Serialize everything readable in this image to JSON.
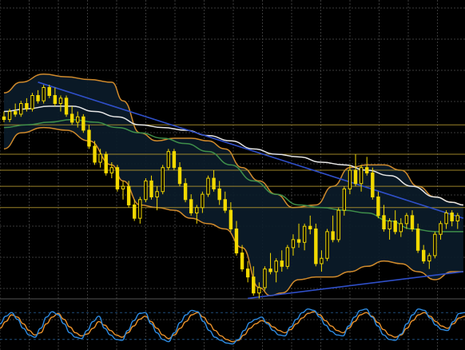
{
  "chart_data": {
    "type": "candlestick",
    "title": "",
    "xlabel": "",
    "ylabel": "",
    "grid": true,
    "price_panel": {
      "ylim": [
        0,
        100
      ],
      "candles": [
        {
          "x": 1,
          "o": 64,
          "h": 66,
          "l": 62,
          "c": 63
        },
        {
          "x": 2,
          "o": 63,
          "h": 67,
          "l": 62,
          "c": 66
        },
        {
          "x": 3,
          "o": 66,
          "h": 69,
          "l": 64,
          "c": 65
        },
        {
          "x": 4,
          "o": 65,
          "h": 70,
          "l": 64,
          "c": 69
        },
        {
          "x": 5,
          "o": 69,
          "h": 71,
          "l": 66,
          "c": 67
        },
        {
          "x": 6,
          "o": 67,
          "h": 73,
          "l": 66,
          "c": 72
        },
        {
          "x": 7,
          "o": 72,
          "h": 74,
          "l": 69,
          "c": 70
        },
        {
          "x": 8,
          "o": 70,
          "h": 76,
          "l": 69,
          "c": 75
        },
        {
          "x": 9,
          "o": 75,
          "h": 76,
          "l": 71,
          "c": 72
        },
        {
          "x": 10,
          "o": 72,
          "h": 75,
          "l": 68,
          "c": 69
        },
        {
          "x": 11,
          "o": 69,
          "h": 72,
          "l": 66,
          "c": 71
        },
        {
          "x": 12,
          "o": 71,
          "h": 72,
          "l": 64,
          "c": 65
        },
        {
          "x": 13,
          "o": 65,
          "h": 68,
          "l": 61,
          "c": 62
        },
        {
          "x": 14,
          "o": 62,
          "h": 66,
          "l": 60,
          "c": 64
        },
        {
          "x": 15,
          "o": 64,
          "h": 65,
          "l": 58,
          "c": 59
        },
        {
          "x": 16,
          "o": 59,
          "h": 61,
          "l": 52,
          "c": 53
        },
        {
          "x": 17,
          "o": 53,
          "h": 55,
          "l": 46,
          "c": 47
        },
        {
          "x": 18,
          "o": 47,
          "h": 52,
          "l": 45,
          "c": 50
        },
        {
          "x": 19,
          "o": 50,
          "h": 51,
          "l": 42,
          "c": 43
        },
        {
          "x": 20,
          "o": 43,
          "h": 47,
          "l": 41,
          "c": 45
        },
        {
          "x": 21,
          "o": 45,
          "h": 46,
          "l": 36,
          "c": 37
        },
        {
          "x": 22,
          "o": 37,
          "h": 40,
          "l": 33,
          "c": 38
        },
        {
          "x": 23,
          "o": 38,
          "h": 40,
          "l": 30,
          "c": 31
        },
        {
          "x": 24,
          "o": 31,
          "h": 33,
          "l": 25,
          "c": 26
        },
        {
          "x": 25,
          "o": 26,
          "h": 34,
          "l": 24,
          "c": 33
        },
        {
          "x": 26,
          "o": 33,
          "h": 41,
          "l": 32,
          "c": 40
        },
        {
          "x": 27,
          "o": 40,
          "h": 42,
          "l": 33,
          "c": 34
        },
        {
          "x": 28,
          "o": 34,
          "h": 38,
          "l": 29,
          "c": 36
        },
        {
          "x": 29,
          "o": 36,
          "h": 46,
          "l": 35,
          "c": 45
        },
        {
          "x": 30,
          "o": 45,
          "h": 52,
          "l": 44,
          "c": 51
        },
        {
          "x": 31,
          "o": 51,
          "h": 52,
          "l": 44,
          "c": 45
        },
        {
          "x": 32,
          "o": 45,
          "h": 47,
          "l": 38,
          "c": 39
        },
        {
          "x": 33,
          "o": 39,
          "h": 41,
          "l": 32,
          "c": 33
        },
        {
          "x": 34,
          "o": 33,
          "h": 35,
          "l": 27,
          "c": 28
        },
        {
          "x": 35,
          "o": 28,
          "h": 31,
          "l": 24,
          "c": 30
        },
        {
          "x": 36,
          "o": 30,
          "h": 36,
          "l": 28,
          "c": 35
        },
        {
          "x": 37,
          "o": 35,
          "h": 42,
          "l": 34,
          "c": 41
        },
        {
          "x": 38,
          "o": 41,
          "h": 44,
          "l": 36,
          "c": 37
        },
        {
          "x": 39,
          "o": 37,
          "h": 40,
          "l": 31,
          "c": 33
        },
        {
          "x": 40,
          "o": 33,
          "h": 36,
          "l": 28,
          "c": 29
        },
        {
          "x": 41,
          "o": 29,
          "h": 32,
          "l": 21,
          "c": 22
        },
        {
          "x": 42,
          "o": 22,
          "h": 25,
          "l": 12,
          "c": 13
        },
        {
          "x": 43,
          "o": 13,
          "h": 16,
          "l": 6,
          "c": 7
        },
        {
          "x": 44,
          "o": 7,
          "h": 10,
          "l": 2,
          "c": 4
        },
        {
          "x": 45,
          "o": 4,
          "h": 8,
          "l": -3,
          "c": -2
        },
        {
          "x": 46,
          "o": -2,
          "h": 2,
          "l": -4,
          "c": 0
        },
        {
          "x": 47,
          "o": 0,
          "h": 8,
          "l": -1,
          "c": 7
        },
        {
          "x": 48,
          "o": 7,
          "h": 13,
          "l": 5,
          "c": 6
        },
        {
          "x": 49,
          "o": 6,
          "h": 11,
          "l": 2,
          "c": 10
        },
        {
          "x": 50,
          "o": 10,
          "h": 14,
          "l": 6,
          "c": 8
        },
        {
          "x": 51,
          "o": 8,
          "h": 16,
          "l": 7,
          "c": 15
        },
        {
          "x": 52,
          "o": 15,
          "h": 20,
          "l": 12,
          "c": 18
        },
        {
          "x": 53,
          "o": 18,
          "h": 24,
          "l": 15,
          "c": 17
        },
        {
          "x": 54,
          "o": 17,
          "h": 24,
          "l": 14,
          "c": 23
        },
        {
          "x": 55,
          "o": 23,
          "h": 27,
          "l": 20,
          "c": 22
        },
        {
          "x": 56,
          "o": 22,
          "h": 24,
          "l": 8,
          "c": 9
        },
        {
          "x": 57,
          "o": 9,
          "h": 14,
          "l": 6,
          "c": 11
        },
        {
          "x": 58,
          "o": 11,
          "h": 22,
          "l": 10,
          "c": 21
        },
        {
          "x": 59,
          "o": 21,
          "h": 27,
          "l": 17,
          "c": 18
        },
        {
          "x": 60,
          "o": 18,
          "h": 30,
          "l": 17,
          "c": 29
        },
        {
          "x": 61,
          "o": 29,
          "h": 38,
          "l": 27,
          "c": 37
        },
        {
          "x": 62,
          "o": 37,
          "h": 46,
          "l": 35,
          "c": 44
        },
        {
          "x": 63,
          "o": 44,
          "h": 50,
          "l": 38,
          "c": 39
        },
        {
          "x": 64,
          "o": 39,
          "h": 46,
          "l": 36,
          "c": 45
        },
        {
          "x": 65,
          "o": 45,
          "h": 49,
          "l": 42,
          "c": 43
        },
        {
          "x": 66,
          "o": 43,
          "h": 45,
          "l": 33,
          "c": 34
        },
        {
          "x": 67,
          "o": 34,
          "h": 36,
          "l": 26,
          "c": 27
        },
        {
          "x": 68,
          "o": 27,
          "h": 31,
          "l": 21,
          "c": 22
        },
        {
          "x": 69,
          "o": 22,
          "h": 26,
          "l": 18,
          "c": 25
        },
        {
          "x": 70,
          "o": 25,
          "h": 29,
          "l": 20,
          "c": 21
        },
        {
          "x": 71,
          "o": 21,
          "h": 26,
          "l": 19,
          "c": 24
        },
        {
          "x": 72,
          "o": 24,
          "h": 28,
          "l": 22,
          "c": 27
        },
        {
          "x": 73,
          "o": 27,
          "h": 29,
          "l": 21,
          "c": 22
        },
        {
          "x": 74,
          "o": 22,
          "h": 24,
          "l": 13,
          "c": 14
        },
        {
          "x": 75,
          "o": 14,
          "h": 16,
          "l": 9,
          "c": 10
        },
        {
          "x": 76,
          "o": 10,
          "h": 13,
          "l": 7,
          "c": 12
        },
        {
          "x": 77,
          "o": 12,
          "h": 21,
          "l": 11,
          "c": 20
        },
        {
          "x": 78,
          "o": 20,
          "h": 25,
          "l": 18,
          "c": 24
        },
        {
          "x": 79,
          "o": 24,
          "h": 29,
          "l": 22,
          "c": 28
        },
        {
          "x": 80,
          "o": 28,
          "h": 29,
          "l": 23,
          "c": 25
        },
        {
          "x": 81,
          "o": 25,
          "h": 28,
          "l": 22,
          "c": 27
        }
      ],
      "bollinger_upper": [
        [
          1,
          73
        ],
        [
          4,
          77
        ],
        [
          8,
          80
        ],
        [
          12,
          79
        ],
        [
          16,
          78
        ],
        [
          20,
          77
        ],
        [
          22,
          70
        ],
        [
          25,
          58
        ],
        [
          28,
          55
        ],
        [
          31,
          56
        ],
        [
          34,
          56
        ],
        [
          37,
          55
        ],
        [
          40,
          52
        ],
        [
          43,
          45
        ],
        [
          46,
          40
        ],
        [
          49,
          35
        ],
        [
          52,
          30
        ],
        [
          56,
          31
        ],
        [
          59,
          38
        ],
        [
          62,
          45
        ],
        [
          65,
          46
        ],
        [
          68,
          46
        ],
        [
          71,
          44
        ],
        [
          74,
          38
        ],
        [
          77,
          34
        ],
        [
          80,
          32
        ],
        [
          82,
          31
        ]
      ],
      "bollinger_lower": [
        [
          1,
          52
        ],
        [
          4,
          58
        ],
        [
          8,
          60
        ],
        [
          12,
          59
        ],
        [
          16,
          55
        ],
        [
          20,
          46
        ],
        [
          22,
          40
        ],
        [
          25,
          31
        ],
        [
          28,
          30
        ],
        [
          31,
          29
        ],
        [
          34,
          26
        ],
        [
          37,
          24
        ],
        [
          40,
          22
        ],
        [
          43,
          15
        ],
        [
          46,
          0
        ],
        [
          48,
          -3
        ],
        [
          50,
          -2
        ],
        [
          53,
          3
        ],
        [
          56,
          4
        ],
        [
          59,
          4
        ],
        [
          62,
          6
        ],
        [
          65,
          8
        ],
        [
          68,
          10
        ],
        [
          71,
          9
        ],
        [
          74,
          6
        ],
        [
          77,
          3
        ],
        [
          80,
          6
        ],
        [
          82,
          6
        ]
      ],
      "sma_white": [
        [
          1,
          66
        ],
        [
          5,
          67
        ],
        [
          9,
          68
        ],
        [
          13,
          68
        ],
        [
          17,
          66
        ],
        [
          21,
          64
        ],
        [
          25,
          61
        ],
        [
          29,
          60
        ],
        [
          33,
          59
        ],
        [
          37,
          57
        ],
        [
          41,
          55
        ],
        [
          45,
          52
        ],
        [
          49,
          50
        ],
        [
          53,
          49
        ],
        [
          57,
          47
        ],
        [
          61,
          46
        ],
        [
          65,
          44
        ],
        [
          69,
          42
        ],
        [
          73,
          38
        ],
        [
          77,
          34
        ],
        [
          80,
          32
        ],
        [
          82,
          31
        ]
      ],
      "sma_green": [
        [
          1,
          60
        ],
        [
          5,
          61
        ],
        [
          9,
          62
        ],
        [
          13,
          63
        ],
        [
          17,
          62
        ],
        [
          21,
          60
        ],
        [
          25,
          58
        ],
        [
          29,
          56
        ],
        [
          33,
          54
        ],
        [
          37,
          51
        ],
        [
          41,
          46
        ],
        [
          45,
          40
        ],
        [
          49,
          35
        ],
        [
          53,
          31
        ],
        [
          57,
          30
        ],
        [
          61,
          29
        ],
        [
          65,
          28
        ],
        [
          69,
          25
        ],
        [
          73,
          22
        ],
        [
          77,
          21
        ],
        [
          80,
          21
        ],
        [
          82,
          21
        ]
      ],
      "trendline_upper": [
        [
          7,
          77
        ],
        [
          82,
          26
        ]
      ],
      "trendline_lower": [
        [
          44,
          -4
        ],
        [
          82,
          6
        ]
      ],
      "horizontal_levels": [
        61,
        50,
        44,
        38,
        30
      ]
    },
    "oscillator_panel": {
      "ylim": [
        0,
        100
      ],
      "levels": [
        80,
        20
      ],
      "series": [
        {
          "color": "#e8902a",
          "values": [
            45,
            60,
            75,
            70,
            55,
            40,
            30,
            35,
            55,
            70,
            78,
            65,
            48,
            35,
            28,
            32,
            45,
            60,
            52,
            40,
            30,
            25,
            35,
            50,
            65,
            72,
            60,
            45,
            30,
            22,
            30,
            45,
            60,
            75,
            80,
            70,
            55,
            40,
            28,
            20,
            15,
            18,
            30,
            45,
            55,
            62,
            58,
            48,
            40,
            35,
            42,
            55,
            68,
            78,
            82,
            75,
            62,
            50,
            40,
            35,
            45,
            60,
            75,
            80,
            72,
            58,
            42,
            30,
            25,
            30,
            45,
            62,
            75,
            80,
            72,
            60,
            50,
            45,
            55,
            68,
            72
          ]
        },
        {
          "color": "#2d8ae0",
          "values": [
            55,
            72,
            80,
            65,
            45,
            30,
            25,
            45,
            70,
            82,
            75,
            55,
            35,
            25,
            22,
            40,
            60,
            72,
            45,
            30,
            20,
            18,
            40,
            62,
            78,
            80,
            55,
            35,
            20,
            15,
            35,
            58,
            75,
            85,
            82,
            60,
            40,
            25,
            18,
            12,
            10,
            20,
            40,
            58,
            65,
            70,
            55,
            40,
            30,
            28,
            48,
            65,
            80,
            88,
            85,
            70,
            52,
            38,
            30,
            28,
            50,
            70,
            85,
            88,
            70,
            50,
            30,
            20,
            18,
            32,
            55,
            75,
            88,
            85,
            68,
            52,
            42,
            40,
            60,
            78,
            80
          ]
        }
      ]
    },
    "colors": {
      "background": "#000000",
      "grid": "#3a3a3a",
      "candle_up": "#f2d900",
      "candle_down": "#f2d900",
      "bollinger": "#d08a2c",
      "sma_white": "#e6e6e6",
      "sma_green": "#3f8f4a",
      "trendline": "#2f4fc8",
      "levels": "#b79a30",
      "band_fill": "#0b1c2a"
    }
  }
}
